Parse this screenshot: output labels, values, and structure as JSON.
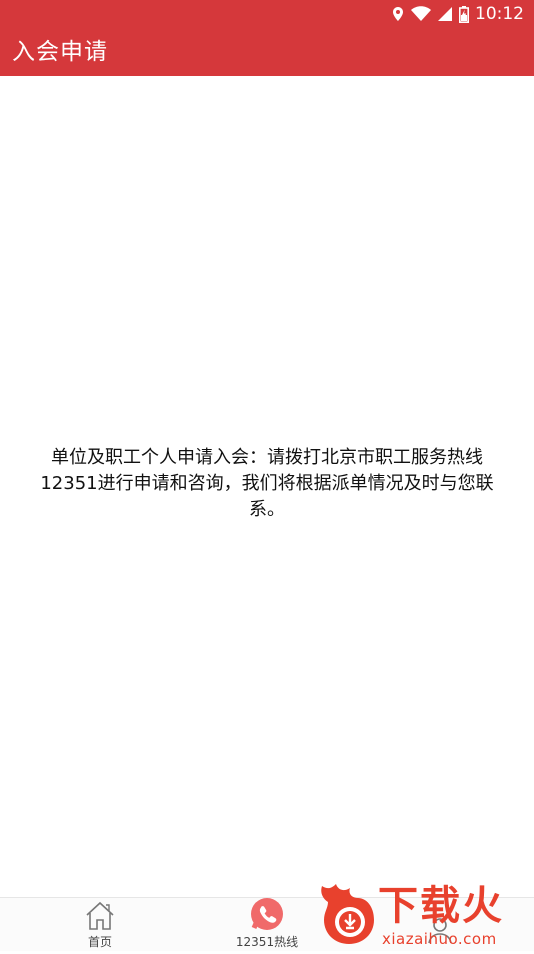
{
  "status_bar": {
    "time": "10:12",
    "icons": [
      "location-icon",
      "wifi-icon",
      "signal-icon",
      "battery-icon"
    ]
  },
  "app_bar": {
    "title": "入会申请",
    "background_color": "#d5383b"
  },
  "main": {
    "message": "单位及职工个人申请入会：请拨打北京市职工服务热线12351进行申请和咨询，我们将根据派单情况及时与您联系。"
  },
  "bottom_nav": {
    "items": [
      {
        "label": "首页",
        "icon": "home-icon"
      },
      {
        "label": "12351热线",
        "icon": "phone-hotline-icon"
      },
      {
        "label": "",
        "icon": "profile-icon"
      }
    ]
  },
  "watermark": {
    "brand": "下载火",
    "url": "xiazaihuo.com",
    "color": "#e8412d"
  }
}
